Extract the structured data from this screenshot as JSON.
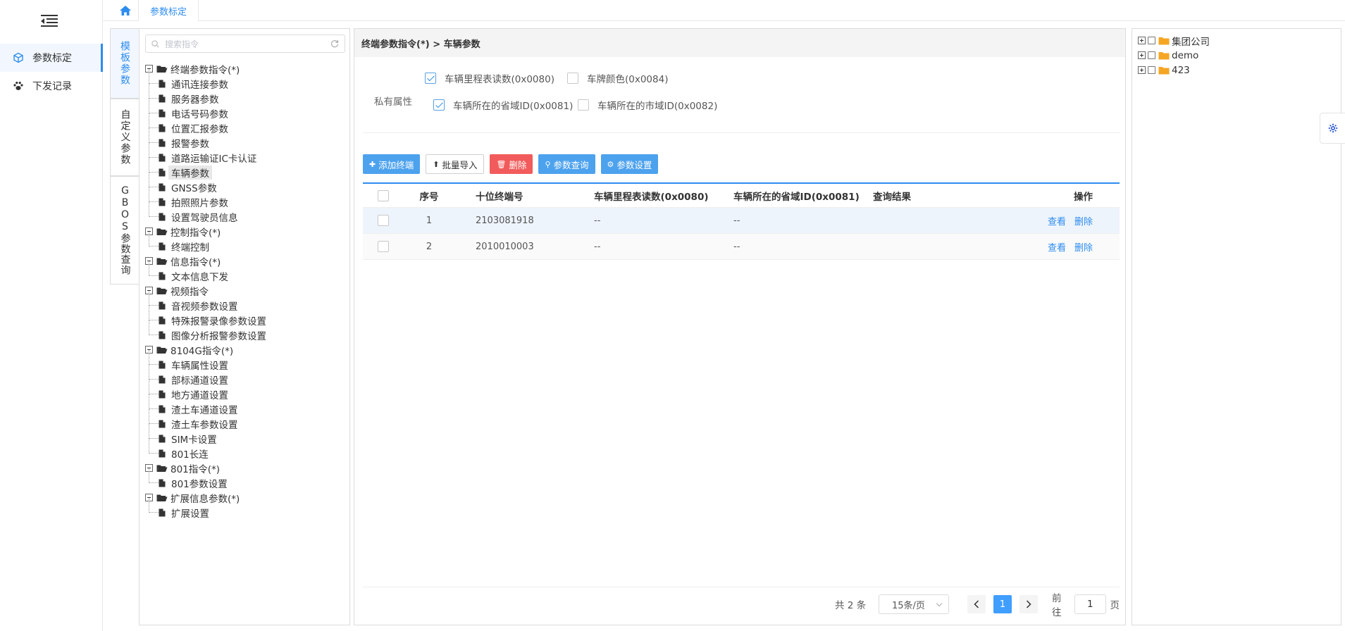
{
  "nav": {
    "items": [
      {
        "label": "参数标定",
        "icon": "cube-icon",
        "active": true
      },
      {
        "label": "下发记录",
        "icon": "paw-icon",
        "active": false
      }
    ]
  },
  "topbar": {
    "tabs": [
      {
        "label": "参数标定",
        "active": true
      }
    ]
  },
  "vtabs": [
    {
      "label": "模板参数",
      "active": true
    },
    {
      "label": "自定义参数",
      "active": false
    },
    {
      "label": "GBOS参数查询",
      "active": false
    }
  ],
  "search": {
    "placeholder": "搜索指令"
  },
  "tree": [
    {
      "label": "终端参数指令(*)",
      "children": [
        "通讯连接参数",
        "服务器参数",
        "电话号码参数",
        "位置汇报参数",
        "报警参数",
        "道路运输证IC卡认证",
        "车辆参数",
        "GNSS参数",
        "拍照照片参数",
        "设置驾驶员信息"
      ],
      "selected_child": 6
    },
    {
      "label": "控制指令(*)",
      "children": [
        "终端控制"
      ]
    },
    {
      "label": "信息指令(*)",
      "children": [
        "文本信息下发"
      ]
    },
    {
      "label": "视频指令",
      "children": [
        "音视频参数设置",
        "特殊报警录像参数设置",
        "图像分析报警参数设置"
      ]
    },
    {
      "label": "8104G指令(*)",
      "children": [
        "车辆属性设置",
        "部标通道设置",
        "地方通道设置",
        "渣土车通道设置",
        "渣土车参数设置",
        "SIM卡设置",
        "801长连"
      ]
    },
    {
      "label": "801指令(*)",
      "children": [
        "801参数设置"
      ]
    },
    {
      "label": "扩展信息参数(*)",
      "children": [
        "扩展设置"
      ]
    }
  ],
  "main": {
    "breadcrumb": "终端参数指令(*) > 车辆参数",
    "props_label": "私有属性",
    "props": [
      {
        "label": "车辆里程表读数(0x0080)",
        "checked": true
      },
      {
        "label": "车牌颜色(0x0084)",
        "checked": false
      },
      {
        "label": "车辆所在的省域ID(0x0081)",
        "checked": true
      },
      {
        "label": "车辆所在的市域ID(0x0082)",
        "checked": false
      }
    ],
    "toolbar": {
      "add": "添加终端",
      "import": "批量导入",
      "delete": "删除",
      "query": "参数查询",
      "settings": "参数设置"
    },
    "table": {
      "headers": [
        "序号",
        "十位终端号",
        "车辆里程表读数(0x0080)",
        "车辆所在的省域ID(0x0081)",
        "查询结果",
        "操作"
      ],
      "rows": [
        {
          "no": "1",
          "terminal": "2103081918",
          "a": "--",
          "b": "--",
          "result": ""
        },
        {
          "no": "2",
          "terminal": "2010010003",
          "a": "--",
          "b": "--",
          "result": ""
        }
      ],
      "view_label": "查看",
      "delete_label": "删除"
    },
    "pager": {
      "total": "共 2 条",
      "page_size": "15条/页",
      "current": "1",
      "goto_prefix": "前往",
      "goto_value": "1",
      "goto_suffix": "页"
    }
  },
  "right_tree": [
    {
      "label": "集团公司"
    },
    {
      "label": "demo"
    },
    {
      "label": "423"
    }
  ],
  "colors": {
    "accent": "#2d8cf0",
    "danger": "#f25b5b",
    "folder": "#f5a623"
  }
}
